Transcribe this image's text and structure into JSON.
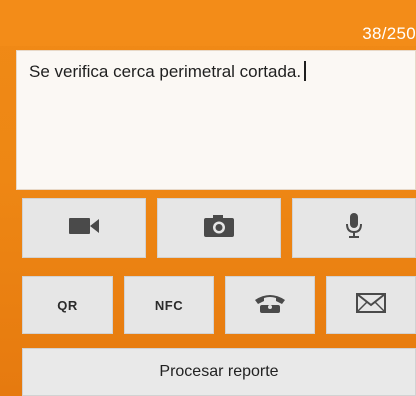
{
  "report": {
    "char_counter": "38/250",
    "text": "Se verifica cerca perimetral cortada."
  },
  "media_buttons": [
    {
      "name": "video-camera-icon"
    },
    {
      "name": "photo-camera-icon"
    },
    {
      "name": "microphone-icon"
    }
  ],
  "action_buttons": {
    "qr_label": "QR",
    "nfc_label": "NFC",
    "phone_icon": "telephone-icon",
    "mail_icon": "envelope-icon"
  },
  "submit_label": "Procesar reporte",
  "colors": {
    "background": "#ee8714",
    "button": "#e6e6e6",
    "icon": "#4a4a4a"
  }
}
